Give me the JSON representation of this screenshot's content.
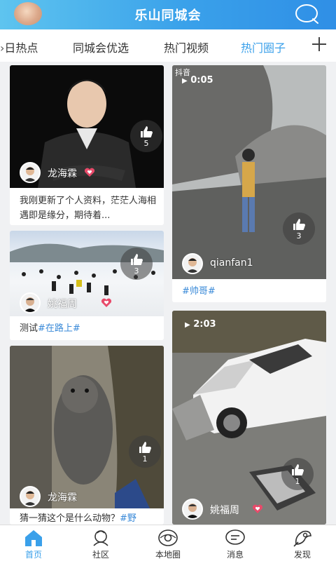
{
  "app": {
    "title": "乐山同城会"
  },
  "tabs": [
    {
      "label": "日热点"
    },
    {
      "label": "同城会优选"
    },
    {
      "label": "热门视频"
    },
    {
      "label": "热门圈子",
      "active": true
    }
  ],
  "cards": [
    {
      "user": "龙海霖",
      "likes": "5",
      "caption": "我刚更新了个人资料，茫茫人海相遇即是缘分，期待着..."
    },
    {
      "user": "姚福周",
      "likes": "3",
      "caption_plain": "测试",
      "caption_tag": "#在路上#"
    },
    {
      "user": "龙海霖",
      "likes": "1",
      "caption_plain": "猜一猜这个是什么动物？",
      "caption_tag": "#野"
    },
    {
      "user": "qianfan1",
      "likes": "3",
      "caption_tag": "#帅哥#",
      "video_badge": "抖音",
      "video_time": "0:05"
    },
    {
      "user": "姚福周",
      "likes": "1",
      "video_time": "2:03"
    }
  ],
  "bottom_nav": [
    {
      "label": "首页",
      "icon": "home-icon",
      "active": true
    },
    {
      "label": "社区",
      "icon": "community-icon"
    },
    {
      "label": "本地圈",
      "icon": "local-circle-icon"
    },
    {
      "label": "消息",
      "icon": "message-icon"
    },
    {
      "label": "发现",
      "icon": "discover-icon"
    }
  ],
  "colors": {
    "accent": "#3aa0ea",
    "heart": "#e84a6a",
    "tag": "#3a8ad8"
  }
}
